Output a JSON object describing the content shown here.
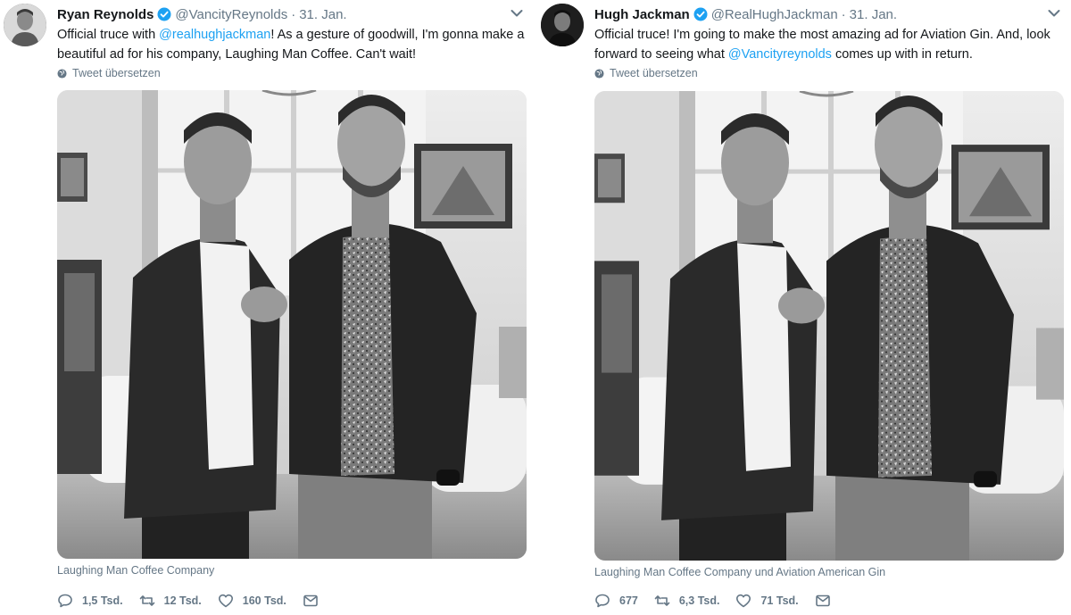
{
  "tweets": [
    {
      "name": "Ryan Reynolds",
      "handle": "@VancityReynolds",
      "separator": "·",
      "date": "31. Jan.",
      "text_before": "Official truce with ",
      "mention": "@realhughjackman",
      "text_after": "! As a gesture of goodwill, I'm gonna make a beautiful ad for his company, Laughing Man Coffee. Can't wait!",
      "translate_label": "Tweet übersetzen",
      "tagged": "Laughing Man Coffee Company",
      "replies": "1,5 Tsd.",
      "retweets": "12 Tsd.",
      "likes": "160 Tsd."
    },
    {
      "name": "Hugh Jackman",
      "handle": "@RealHughJackman",
      "separator": "·",
      "date": "31. Jan.",
      "text_before": "Official truce! I'm going to make the most amazing ad for Aviation Gin. And,  look forward to seeing what ",
      "mention": "@Vancityreynolds",
      "text_after": " comes up with in return.",
      "translate_label": "Tweet übersetzen",
      "tagged": "Laughing Man Coffee Company und Aviation American Gin",
      "replies": "677",
      "retweets": "6,3 Tsd.",
      "likes": "71 Tsd."
    }
  ],
  "colors": {
    "text": "#14171a",
    "secondary": "#657786",
    "link": "#1da1f2",
    "verified": "#1da1f2"
  },
  "icons": [
    "verified-badge-icon",
    "chevron-down-icon",
    "globe-icon",
    "reply-icon",
    "retweet-icon",
    "like-icon",
    "direct-message-icon"
  ]
}
